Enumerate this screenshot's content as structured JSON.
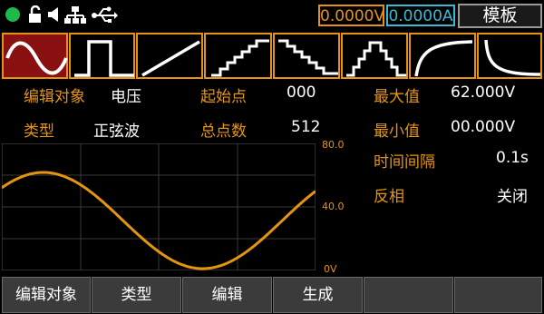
{
  "status_bar": {
    "indicator_color": "#1fb84a",
    "icons": [
      "status-dot",
      "unlock-icon",
      "speaker-icon",
      "network-icon",
      "usb-icon"
    ],
    "voltage_readout": "0.0000V",
    "current_readout": "0.0000A",
    "template_button": "模板"
  },
  "waveforms": [
    "sine",
    "square",
    "ramp",
    "staircase-up",
    "staircase-down",
    "staircase-up-down",
    "exponential-rise",
    "exponential-fall"
  ],
  "selected_waveform": "sine",
  "params": {
    "edit_object_label": "编辑对象",
    "edit_object_value": "电压",
    "start_point_label": "起始点",
    "start_point_value": "000",
    "max_label": "最大值",
    "max_value": "62.000V",
    "type_label": "类型",
    "type_value": "正弦波",
    "total_points_label": "总点数",
    "total_points_value": "512",
    "min_label": "最小值",
    "min_value": "00.000V",
    "interval_label": "时间间隔",
    "interval_value": "0.1s",
    "invert_label": "反相",
    "invert_value": "关闭"
  },
  "plot": {
    "y_ticks": [
      "80.0",
      "40.0",
      "0V"
    ],
    "line_color": "#e59412"
  },
  "softkeys": [
    "编辑对象",
    "类型",
    "编辑",
    "生成",
    "",
    ""
  ],
  "colors": {
    "accent": "#e59412",
    "current": "#39b9d4",
    "active_wave": "#8a1111",
    "softkey_bg": "#3b3b3b"
  }
}
